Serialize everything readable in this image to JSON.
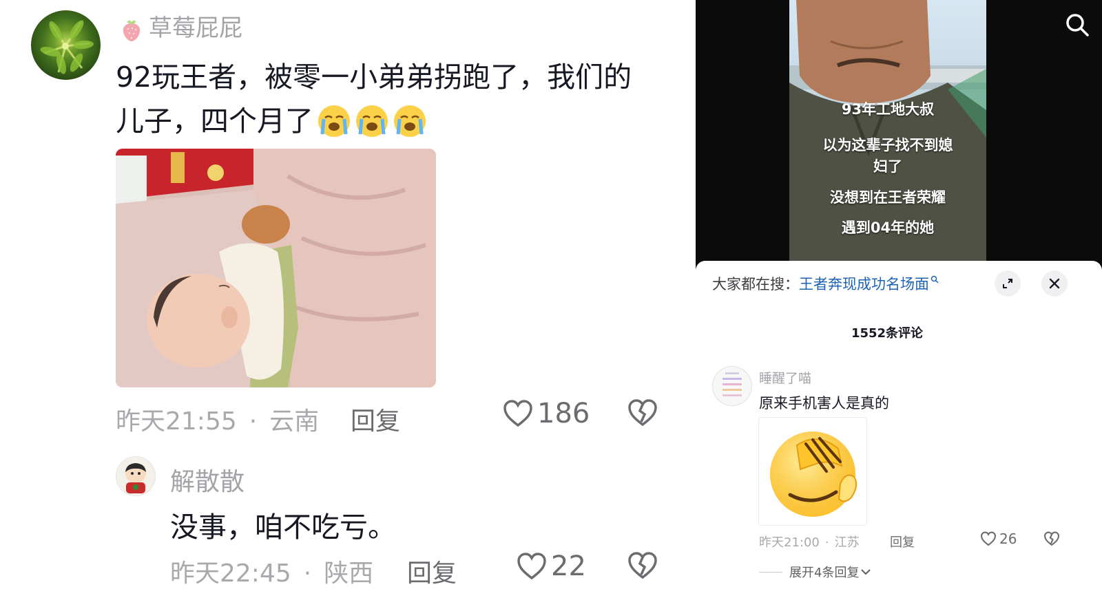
{
  "left": {
    "main_comment": {
      "username": "草莓屁屁",
      "text_line1": "92玩王者，被零一小弟弟拐跑了，我们的",
      "text_line2": "儿子，四个月了",
      "time": "昨天21:55",
      "location": "云南",
      "reply_label": "回复",
      "likes": "186",
      "photo_icon": "sleeping-baby-photo"
    },
    "sub_comment": {
      "username": "解散散",
      "text": "没事，咱不吃亏。",
      "time": "昨天22:45",
      "location": "陕西",
      "reply_label": "回复",
      "likes": "22"
    },
    "separator_dot": "·"
  },
  "right": {
    "video": {
      "captions": [
        "93年工地大叔",
        "以为这辈子找不到媳",
        "妇了",
        "没想到在王者荣耀",
        "遇到04年的她"
      ],
      "search_icon": "search-icon"
    },
    "sheet": {
      "hot_search_label": "大家都在搜：",
      "hot_search_keyword": "王者奔现成功名场面",
      "comment_count": "1552条评论",
      "comment": {
        "username": "睡醒了喵",
        "text": "原来手机害人是真的",
        "time": "昨天21:00",
        "location": "江苏",
        "reply_label": "回复",
        "likes": "26",
        "expand_label": "展开4条回复"
      }
    }
  },
  "colors": {
    "text_primary": "#161823",
    "text_muted": "#a3a3a8",
    "link_blue": "#1d63b5",
    "video_bg": "#0b0b0b"
  }
}
